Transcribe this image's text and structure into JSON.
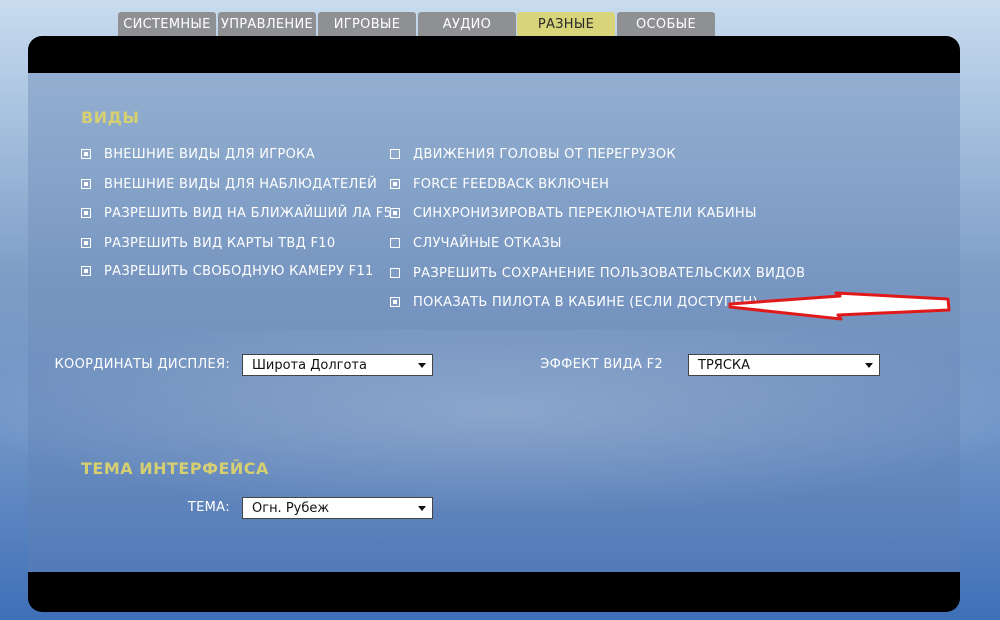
{
  "tabs": [
    {
      "label": "СИСТЕМНЫЕ"
    },
    {
      "label": "УПРАВЛЕНИЕ"
    },
    {
      "label": "ИГРОВЫЕ"
    },
    {
      "label": "АУДИО"
    },
    {
      "label": "РАЗНЫЕ",
      "active": true
    },
    {
      "label": "ОСОБЫЕ"
    }
  ],
  "views": {
    "title": "ВИДЫ",
    "left_options": [
      {
        "label": "ВНЕШНИЕ ВИДЫ ДЛЯ ИГРОКА",
        "checked": true
      },
      {
        "label": "ВНЕШНИЕ ВИДЫ ДЛЯ НАБЛЮДАТЕЛЕЙ",
        "checked": true
      },
      {
        "label": "РАЗРЕШИТЬ ВИД НА БЛИЖАЙШИЙ ЛА F5",
        "checked": true
      },
      {
        "label": "РАЗРЕШИТЬ ВИД КАРТЫ ТВД F10",
        "checked": true
      },
      {
        "label": "РАЗРЕШИТЬ СВОБОДНУЮ КАМЕРУ F11",
        "checked": true
      }
    ],
    "right_options": [
      {
        "label": "ДВИЖЕНИЯ ГОЛОВЫ ОТ ПЕРЕГРУЗОК",
        "checked": false
      },
      {
        "label": "FORCE FEEDBACK ВКЛЮЧЕН",
        "checked": true
      },
      {
        "label": "СИНХРОНИЗИРОВАТЬ ПЕРЕКЛЮЧАТЕЛИ КАБИНЫ",
        "checked": true
      },
      {
        "label": "СЛУЧАЙНЫЕ ОТКАЗЫ",
        "checked": false
      },
      {
        "label": "РАЗРЕШИТЬ СОХРАНЕНИЕ ПОЛЬЗОВАТЕЛЬСКИХ ВИДОВ",
        "checked": false
      },
      {
        "label": "ПОКАЗАТЬ ПИЛОТА В КАБИНЕ (ЕСЛИ ДОСТУПЕН)",
        "checked": true
      }
    ],
    "coords_label": "КООРДИНАТЫ ДИСПЛЕЯ:",
    "coords_value": "Широта Долгота",
    "f2_label": "ЭФФЕКТ ВИДА F2",
    "f2_value": "ТРЯСКА"
  },
  "theme": {
    "title": "ТЕМА ИНТЕРФЕЙСА",
    "label": "ТЕМА:",
    "value": "Огн. Рубеж"
  },
  "colors": {
    "accent_title": "#d6cf72",
    "active_tab": "#d8d47a",
    "inactive_tab": "#8f9094",
    "annotation_arrow": "#e01a1a"
  }
}
